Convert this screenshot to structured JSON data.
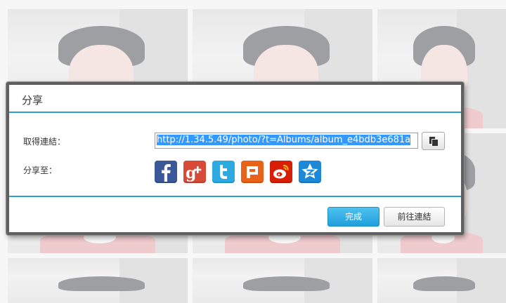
{
  "dialog": {
    "title": "分享",
    "link_label": "取得連結：",
    "link_value": "http://1.34.5.49/photo/?t=Albums/album_e4bdb3e681a",
    "share_label": "分享至：",
    "done_button": "完成",
    "goto_link_button": "前往連結"
  },
  "share_targets": [
    {
      "name": "facebook-icon",
      "color": "#3b5998"
    },
    {
      "name": "google-plus-icon",
      "color": "#d84a38"
    },
    {
      "name": "twitter-icon",
      "color": "#2daae1"
    },
    {
      "name": "plurk-icon",
      "color": "#e8621a"
    },
    {
      "name": "weibo-icon",
      "color": "#d81e06"
    },
    {
      "name": "qzone-icon",
      "color": "#1e88d8"
    }
  ],
  "colors": {
    "accent": "#2a9fd6",
    "primary_button": "#1e9fdc"
  }
}
